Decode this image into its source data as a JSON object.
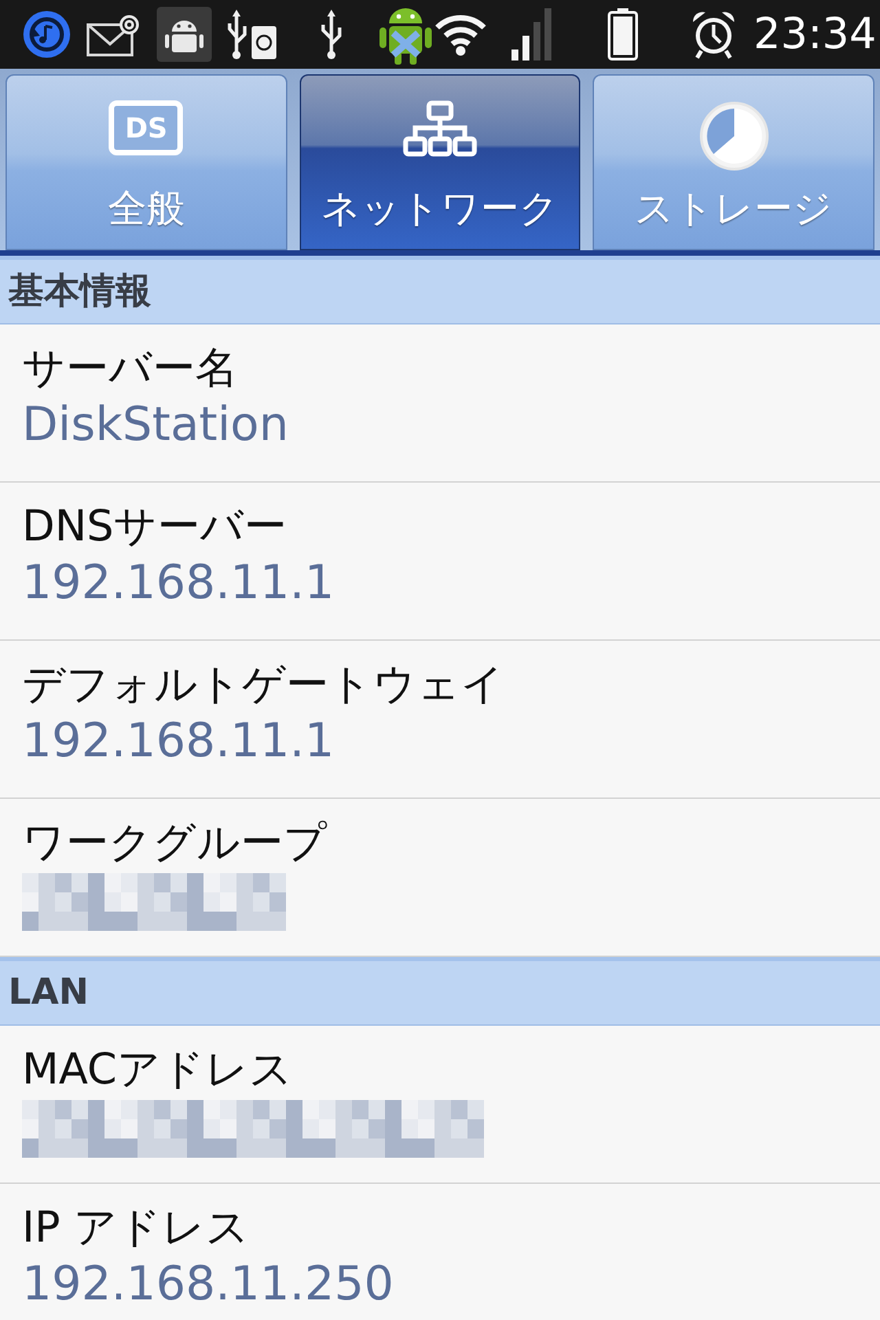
{
  "status_bar": {
    "time": "23:34"
  },
  "tabs": [
    {
      "label": "全般",
      "kind": "general",
      "icon_text": "DS",
      "selected": false
    },
    {
      "label": "ネットワーク",
      "kind": "network",
      "selected": true
    },
    {
      "label": "ストレージ",
      "kind": "storage",
      "selected": false
    }
  ],
  "sections": [
    {
      "title": "基本情報",
      "rows": [
        {
          "label": "サーバー名",
          "value": "DiskStation",
          "redacted": false
        },
        {
          "label": "DNSサーバー",
          "value": "192.168.11.1",
          "redacted": false
        },
        {
          "label": "デフォルトゲートウェイ",
          "value": "192.168.11.1",
          "redacted": false
        },
        {
          "label": "ワークグループ",
          "redacted": true
        }
      ]
    },
    {
      "title": "LAN",
      "rows": [
        {
          "label": "MACアドレス",
          "redacted": true
        },
        {
          "label": "IP アドレス",
          "value": "192.168.11.250",
          "redacted": false
        }
      ]
    }
  ]
}
